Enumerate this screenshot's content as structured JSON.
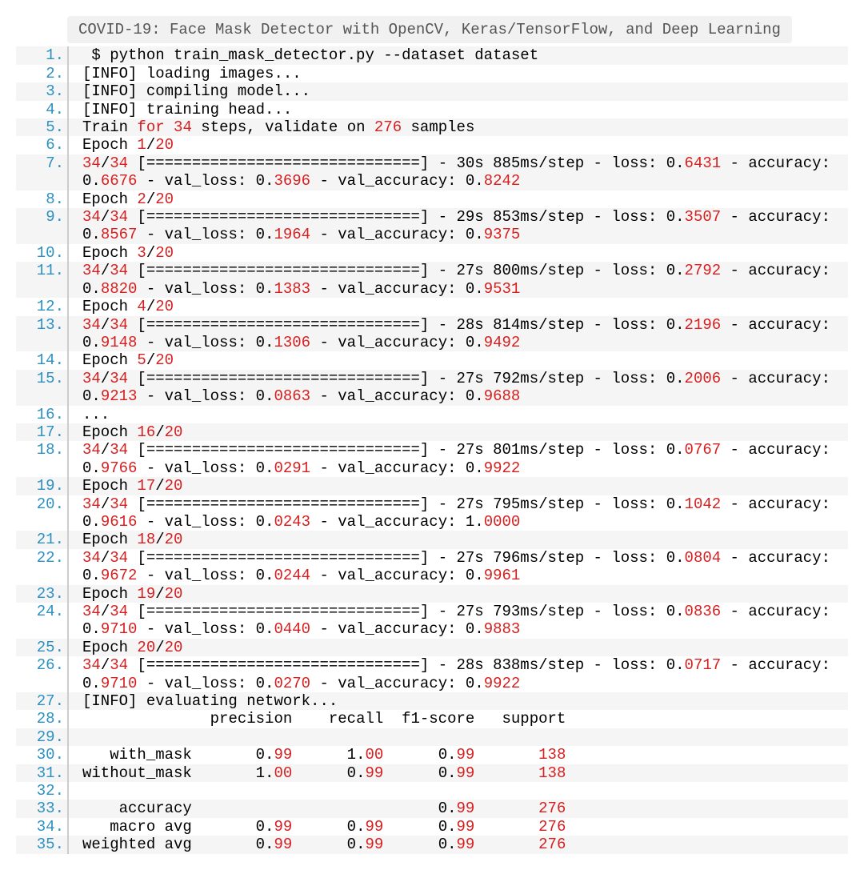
{
  "title": "COVID-19: Face Mask Detector with OpenCV, Keras/TensorFlow, and Deep Learning",
  "lines": [
    {
      "n": "1.",
      "tokens": [
        [
          " $ python train_mask_detector.py --dataset dataset",
          0
        ]
      ]
    },
    {
      "n": "2.",
      "tokens": [
        [
          "[INFO] loading images...",
          0
        ]
      ]
    },
    {
      "n": "3.",
      "tokens": [
        [
          "[INFO] compiling model...",
          0
        ]
      ]
    },
    {
      "n": "4.",
      "tokens": [
        [
          "[INFO] training head...",
          0
        ]
      ]
    },
    {
      "n": "5.",
      "tokens": [
        [
          "Train ",
          0
        ],
        [
          "for",
          1
        ],
        [
          " ",
          0
        ],
        [
          "34",
          1
        ],
        [
          " steps, validate on ",
          0
        ],
        [
          "276",
          1
        ],
        [
          " samples",
          0
        ]
      ]
    },
    {
      "n": "6.",
      "tokens": [
        [
          "Epoch ",
          0
        ],
        [
          "1",
          1
        ],
        [
          "/",
          0
        ],
        [
          "20",
          1
        ]
      ]
    },
    {
      "n": "7.",
      "tokens": [
        [
          "34",
          1
        ],
        [
          "/",
          0
        ],
        [
          "34",
          1
        ],
        [
          " [==============================] - 30s 885ms/step - loss: 0.",
          0
        ],
        [
          "6431",
          1
        ],
        [
          " - accuracy: 0.",
          0
        ],
        [
          "6676",
          1
        ],
        [
          " - val_loss: 0.",
          0
        ],
        [
          "3696",
          1
        ],
        [
          " - val_accuracy: 0.",
          0
        ],
        [
          "8242",
          1
        ]
      ]
    },
    {
      "n": "8.",
      "tokens": [
        [
          "Epoch ",
          0
        ],
        [
          "2",
          1
        ],
        [
          "/",
          0
        ],
        [
          "20",
          1
        ]
      ]
    },
    {
      "n": "9.",
      "tokens": [
        [
          "34",
          1
        ],
        [
          "/",
          0
        ],
        [
          "34",
          1
        ],
        [
          " [==============================] - 29s 853ms/step - loss: 0.",
          0
        ],
        [
          "3507",
          1
        ],
        [
          " - accuracy: 0.",
          0
        ],
        [
          "8567",
          1
        ],
        [
          " - val_loss: 0.",
          0
        ],
        [
          "1964",
          1
        ],
        [
          " - val_accuracy: 0.",
          0
        ],
        [
          "9375",
          1
        ]
      ]
    },
    {
      "n": "10.",
      "tokens": [
        [
          "Epoch ",
          0
        ],
        [
          "3",
          1
        ],
        [
          "/",
          0
        ],
        [
          "20",
          1
        ]
      ]
    },
    {
      "n": "11.",
      "tokens": [
        [
          "34",
          1
        ],
        [
          "/",
          0
        ],
        [
          "34",
          1
        ],
        [
          " [==============================] - 27s 800ms/step - loss: 0.",
          0
        ],
        [
          "2792",
          1
        ],
        [
          " - accuracy: 0.",
          0
        ],
        [
          "8820",
          1
        ],
        [
          " - val_loss: 0.",
          0
        ],
        [
          "1383",
          1
        ],
        [
          " - val_accuracy: 0.",
          0
        ],
        [
          "9531",
          1
        ]
      ]
    },
    {
      "n": "12.",
      "tokens": [
        [
          "Epoch ",
          0
        ],
        [
          "4",
          1
        ],
        [
          "/",
          0
        ],
        [
          "20",
          1
        ]
      ]
    },
    {
      "n": "13.",
      "tokens": [
        [
          "34",
          1
        ],
        [
          "/",
          0
        ],
        [
          "34",
          1
        ],
        [
          " [==============================] - 28s 814ms/step - loss: 0.",
          0
        ],
        [
          "2196",
          1
        ],
        [
          " - accuracy: 0.",
          0
        ],
        [
          "9148",
          1
        ],
        [
          " - val_loss: 0.",
          0
        ],
        [
          "1306",
          1
        ],
        [
          " - val_accuracy: 0.",
          0
        ],
        [
          "9492",
          1
        ]
      ]
    },
    {
      "n": "14.",
      "tokens": [
        [
          "Epoch ",
          0
        ],
        [
          "5",
          1
        ],
        [
          "/",
          0
        ],
        [
          "20",
          1
        ]
      ]
    },
    {
      "n": "15.",
      "tokens": [
        [
          "34",
          1
        ],
        [
          "/",
          0
        ],
        [
          "34",
          1
        ],
        [
          " [==============================] - 27s 792ms/step - loss: 0.",
          0
        ],
        [
          "2006",
          1
        ],
        [
          " - accuracy: 0.",
          0
        ],
        [
          "9213",
          1
        ],
        [
          " - val_loss: 0.",
          0
        ],
        [
          "0863",
          1
        ],
        [
          " - val_accuracy: 0.",
          0
        ],
        [
          "9688",
          1
        ]
      ]
    },
    {
      "n": "16.",
      "tokens": [
        [
          "...",
          0
        ]
      ]
    },
    {
      "n": "17.",
      "tokens": [
        [
          "Epoch ",
          0
        ],
        [
          "16",
          1
        ],
        [
          "/",
          0
        ],
        [
          "20",
          1
        ]
      ]
    },
    {
      "n": "18.",
      "tokens": [
        [
          "34",
          1
        ],
        [
          "/",
          0
        ],
        [
          "34",
          1
        ],
        [
          " [==============================] - 27s 801ms/step - loss: 0.",
          0
        ],
        [
          "0767",
          1
        ],
        [
          " - accuracy: 0.",
          0
        ],
        [
          "9766",
          1
        ],
        [
          " - val_loss: 0.",
          0
        ],
        [
          "0291",
          1
        ],
        [
          " - val_accuracy: 0.",
          0
        ],
        [
          "9922",
          1
        ]
      ]
    },
    {
      "n": "19.",
      "tokens": [
        [
          "Epoch ",
          0
        ],
        [
          "17",
          1
        ],
        [
          "/",
          0
        ],
        [
          "20",
          1
        ]
      ]
    },
    {
      "n": "20.",
      "tokens": [
        [
          "34",
          1
        ],
        [
          "/",
          0
        ],
        [
          "34",
          1
        ],
        [
          " [==============================] - 27s 795ms/step - loss: 0.",
          0
        ],
        [
          "1042",
          1
        ],
        [
          " - accuracy: 0.",
          0
        ],
        [
          "9616",
          1
        ],
        [
          " - val_loss: 0.",
          0
        ],
        [
          "0243",
          1
        ],
        [
          " - val_accuracy: 1.",
          0
        ],
        [
          "0000",
          1
        ]
      ]
    },
    {
      "n": "21.",
      "tokens": [
        [
          "Epoch ",
          0
        ],
        [
          "18",
          1
        ],
        [
          "/",
          0
        ],
        [
          "20",
          1
        ]
      ]
    },
    {
      "n": "22.",
      "tokens": [
        [
          "34",
          1
        ],
        [
          "/",
          0
        ],
        [
          "34",
          1
        ],
        [
          " [==============================] - 27s 796ms/step - loss: 0.",
          0
        ],
        [
          "0804",
          1
        ],
        [
          " - accuracy: 0.",
          0
        ],
        [
          "9672",
          1
        ],
        [
          " - val_loss: 0.",
          0
        ],
        [
          "0244",
          1
        ],
        [
          " - val_accuracy: 0.",
          0
        ],
        [
          "9961",
          1
        ]
      ]
    },
    {
      "n": "23.",
      "tokens": [
        [
          "Epoch ",
          0
        ],
        [
          "19",
          1
        ],
        [
          "/",
          0
        ],
        [
          "20",
          1
        ]
      ]
    },
    {
      "n": "24.",
      "tokens": [
        [
          "34",
          1
        ],
        [
          "/",
          0
        ],
        [
          "34",
          1
        ],
        [
          " [==============================] - 27s 793ms/step - loss: 0.",
          0
        ],
        [
          "0836",
          1
        ],
        [
          " - accuracy: 0.",
          0
        ],
        [
          "9710",
          1
        ],
        [
          " - val_loss: 0.",
          0
        ],
        [
          "0440",
          1
        ],
        [
          " - val_accuracy: 0.",
          0
        ],
        [
          "9883",
          1
        ]
      ]
    },
    {
      "n": "25.",
      "tokens": [
        [
          "Epoch ",
          0
        ],
        [
          "20",
          1
        ],
        [
          "/",
          0
        ],
        [
          "20",
          1
        ]
      ]
    },
    {
      "n": "26.",
      "tokens": [
        [
          "34",
          1
        ],
        [
          "/",
          0
        ],
        [
          "34",
          1
        ],
        [
          " [==============================] - 28s 838ms/step - loss: 0.",
          0
        ],
        [
          "0717",
          1
        ],
        [
          " - accuracy: 0.",
          0
        ],
        [
          "9710",
          1
        ],
        [
          " - val_loss: 0.",
          0
        ],
        [
          "0270",
          1
        ],
        [
          " - val_accuracy: 0.",
          0
        ],
        [
          "9922",
          1
        ]
      ]
    },
    {
      "n": "27.",
      "tokens": [
        [
          "[INFO] evaluating network...",
          0
        ]
      ]
    },
    {
      "n": "28.",
      "tokens": [
        [
          "              precision    recall  f1-score   support",
          0
        ]
      ]
    },
    {
      "n": "29.",
      "tokens": [
        [
          " ",
          0
        ]
      ]
    },
    {
      "n": "30.",
      "tokens": [
        [
          "   with_mask       0.",
          0
        ],
        [
          "99",
          1
        ],
        [
          "      1.",
          0
        ],
        [
          "00",
          1
        ],
        [
          "      0.",
          0
        ],
        [
          "99",
          1
        ],
        [
          "       ",
          0
        ],
        [
          "138",
          1
        ]
      ]
    },
    {
      "n": "31.",
      "tokens": [
        [
          "without_mask       1.",
          0
        ],
        [
          "00",
          1
        ],
        [
          "      0.",
          0
        ],
        [
          "99",
          1
        ],
        [
          "      0.",
          0
        ],
        [
          "99",
          1
        ],
        [
          "       ",
          0
        ],
        [
          "138",
          1
        ]
      ]
    },
    {
      "n": "32.",
      "tokens": [
        [
          " ",
          0
        ]
      ]
    },
    {
      "n": "33.",
      "tokens": [
        [
          "    accuracy                           0.",
          0
        ],
        [
          "99",
          1
        ],
        [
          "       ",
          0
        ],
        [
          "276",
          1
        ]
      ]
    },
    {
      "n": "34.",
      "tokens": [
        [
          "   macro avg       0.",
          0
        ],
        [
          "99",
          1
        ],
        [
          "      0.",
          0
        ],
        [
          "99",
          1
        ],
        [
          "      0.",
          0
        ],
        [
          "99",
          1
        ],
        [
          "       ",
          0
        ],
        [
          "276",
          1
        ]
      ]
    },
    {
      "n": "35.",
      "tokens": [
        [
          "weighted avg       0.",
          0
        ],
        [
          "99",
          1
        ],
        [
          "      0.",
          0
        ],
        [
          "99",
          1
        ],
        [
          "      0.",
          0
        ],
        [
          "99",
          1
        ],
        [
          "       ",
          0
        ],
        [
          "276",
          1
        ]
      ]
    }
  ]
}
